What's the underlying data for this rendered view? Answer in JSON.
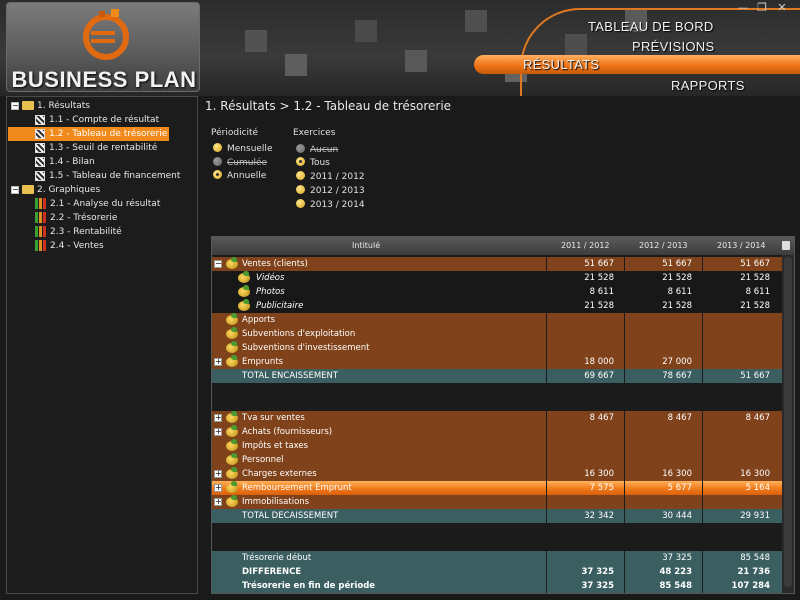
{
  "app": {
    "brand": "BUSINESS PLAN"
  },
  "window_controls": {
    "minimize": "—",
    "maximize": "❐",
    "close": "✕"
  },
  "nav": {
    "tableau_de_bord": "TABLEAU DE BORD",
    "previsions": "PRÉVISIONS",
    "resultats": "RÉSULTATS",
    "rapports": "RAPPORTS"
  },
  "tree": {
    "group1": {
      "toggle": "−",
      "label": "1. Résultats",
      "items": [
        {
          "label": "1.1 -  Compte de résultat"
        },
        {
          "label": "1.2 - Tableau de trésorerie"
        },
        {
          "label": "1.3 - Seuil de rentabilité"
        },
        {
          "label": "1.4 - Bilan"
        },
        {
          "label": "1.5 - Tableau de financement"
        }
      ]
    },
    "group2": {
      "toggle": "−",
      "label": "2. Graphiques",
      "items": [
        {
          "label": "2.1 - Analyse du résultat"
        },
        {
          "label": "2.2 - Trésorerie"
        },
        {
          "label": "2.3 - Rentabilité"
        },
        {
          "label": "2.4 - Ventes"
        }
      ]
    }
  },
  "breadcrumb": "1. Résultats > 1.2 - Tableau de trésorerie",
  "periodicite": {
    "label": "Périodicité",
    "options": [
      "Mensuelle",
      "Cumulée",
      "Annuelle"
    ]
  },
  "exercices": {
    "label": "Exercices",
    "options": [
      "Aucun",
      "Tous",
      "2011 / 2012",
      "2012 / 2013",
      "2013 / 2014"
    ]
  },
  "table": {
    "headers": [
      "Intitulé",
      "2011 / 2012",
      "2012 / 2013",
      "2013 / 2014"
    ],
    "rows": [
      {
        "toggle": "−",
        "label": "Ventes (clients)",
        "values": [
          "51 667",
          "51 667",
          "51 667"
        ]
      },
      {
        "toggle": "",
        "label": "Vidéos",
        "values": [
          "21 528",
          "21 528",
          "21 528"
        ]
      },
      {
        "toggle": "",
        "label": "Photos",
        "values": [
          "8 611",
          "8 611",
          "8 611"
        ]
      },
      {
        "toggle": "",
        "label": "Publicitaire",
        "values": [
          "21 528",
          "21 528",
          "21 528"
        ]
      },
      {
        "toggle": "",
        "label": "Apports",
        "values": [
          "",
          "",
          ""
        ]
      },
      {
        "toggle": "",
        "label": "Subventions d'exploitation",
        "values": [
          "",
          "",
          ""
        ]
      },
      {
        "toggle": "",
        "label": "Subventions d'investissement",
        "values": [
          "",
          "",
          ""
        ]
      },
      {
        "toggle": "+",
        "label": "Emprunts",
        "values": [
          "18 000",
          "27 000",
          ""
        ]
      },
      {
        "toggle": "",
        "label": "TOTAL ENCAISSEMENT",
        "values": [
          "69 667",
          "78 667",
          "51 667"
        ]
      },
      {
        "toggle": "+",
        "label": "Tva sur ventes",
        "values": [
          "8 467",
          "8 467",
          "8 467"
        ]
      },
      {
        "toggle": "+",
        "label": "Achats (fournisseurs)",
        "values": [
          "",
          "",
          ""
        ]
      },
      {
        "toggle": "",
        "label": "Impôts et taxes",
        "values": [
          "",
          "",
          ""
        ]
      },
      {
        "toggle": "",
        "label": "Personnel",
        "values": [
          "",
          "",
          ""
        ]
      },
      {
        "toggle": "+",
        "label": "Charges externes",
        "values": [
          "16 300",
          "16 300",
          "16 300"
        ]
      },
      {
        "toggle": "+",
        "label": "Remboursement Emprunt",
        "values": [
          "7 575",
          "5 677",
          "5 164"
        ]
      },
      {
        "toggle": "+",
        "label": "Immobilisations",
        "values": [
          "",
          "",
          ""
        ]
      },
      {
        "toggle": "",
        "label": "TOTAL DECAISSEMENT",
        "values": [
          "32 342",
          "30 444",
          "29 931"
        ]
      },
      {
        "toggle": "",
        "label": "Trésorerie début",
        "values": [
          "",
          "37 325",
          "85 548"
        ]
      },
      {
        "toggle": "",
        "label": "DIFFERENCE",
        "values": [
          "37 325",
          "48 223",
          "21 736"
        ]
      },
      {
        "toggle": "",
        "label": "Trésorerie en fin de période",
        "values": [
          "37 325",
          "85 548",
          "107 284"
        ]
      }
    ]
  },
  "colors": {
    "accent": "#f08a1c",
    "row_brown": "#80421a",
    "row_teal": "#3b5e60"
  }
}
